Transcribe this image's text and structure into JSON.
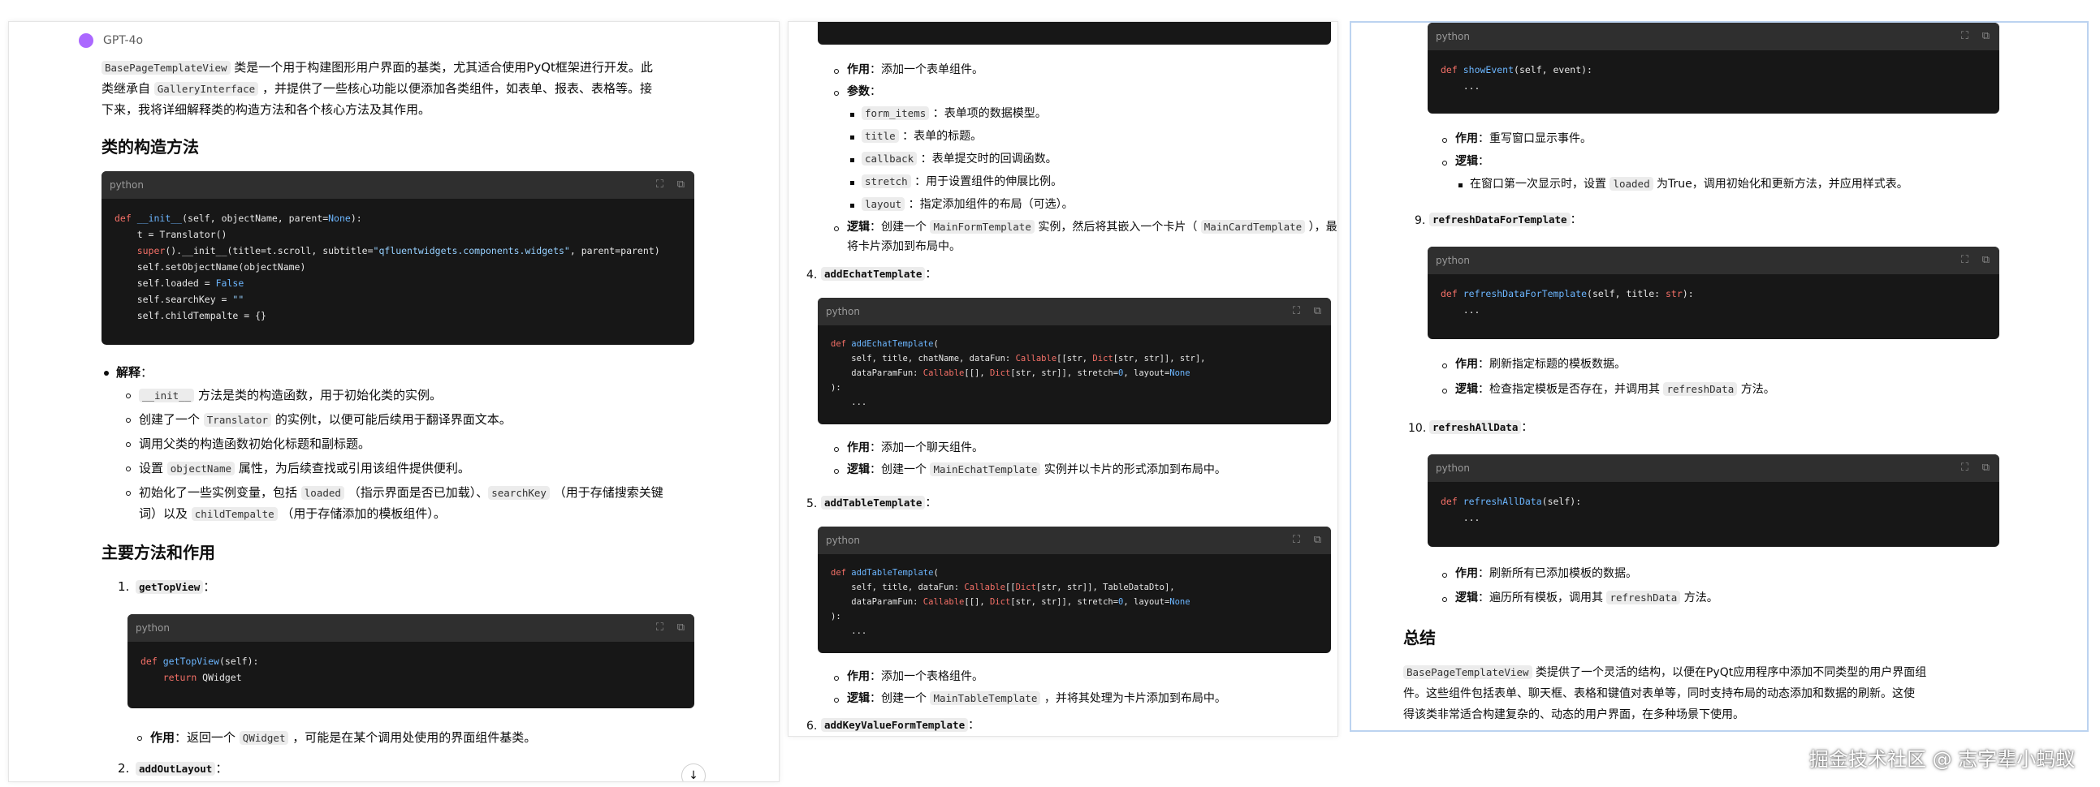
{
  "p1": {
    "model_label": "GPT-4o",
    "intro": {
      "c1": "BasePageTemplateView",
      "t1": " 类是一个用于构建图形用户界面的基类，尤其适合使用PyQt框架进行开发。此",
      "t2": "类继承自 ",
      "c2": "GalleryInterface",
      "t3": " ，并提供了一些核心功能以便添加各类组件，如表单、报表、表格等。接",
      "t4": "下来，我将详细解释类的构造方法和各个核心方法及其作用。"
    },
    "h_ctor": "类的构造方法",
    "code1_lang": "python",
    "explain_label": "解释",
    "explain_items": [
      {
        "code": "__init__",
        "text": " 方法是类的构造函数，用于初始化类的实例。"
      },
      {
        "pre": "创建了一个 ",
        "code": "Translator",
        "text": " 的实例t，以便可能后续用于翻译界面文本。"
      },
      {
        "text": "调用父类的构造函数初始化标题和副标题。"
      },
      {
        "pre": "设置 ",
        "code": "objectName",
        "text": " 属性，为后续查找或引用该组件提供便利。"
      }
    ],
    "explain_last": {
      "a": "初始化了一些实例变量，包括 ",
      "c1": "loaded",
      "b": " （指示界面是否已加载）、",
      "c2": "searchKey",
      "c": " （用于存储搜索关键",
      "d": "词）以及 ",
      "c3": "childTempalte",
      "e": " （用于存储添加的模板组件）。"
    },
    "h_methods": "主要方法和作用",
    "m1_num": "1.",
    "m1_name": "getTopView",
    "colon": "：",
    "code2_lang": "python",
    "m1_role_label": "作用",
    "m1_role_a": "：返回一个 ",
    "m1_role_code": "QWidget",
    "m1_role_b": " ，可能是在某个调用处使用的界面组件基类。",
    "m2_num": "2.",
    "m2_name": "addOutLayout",
    "scroll_down": "↓"
  },
  "p2": {
    "role_label": "作用",
    "param_label": "参数",
    "logic_label": "逻辑",
    "i1_role": "：添加一个表单组件。",
    "params": [
      {
        "code": "form_items",
        "text": " ：表单项的数据模型。"
      },
      {
        "code": "title",
        "text": " ：表单的标题。"
      },
      {
        "code": "callback",
        "text": " ：表单提交时的回调函数。"
      },
      {
        "code": "stretch",
        "text": " ：用于设置组件的伸展比例。"
      },
      {
        "code": "layout",
        "text": " ：指定添加组件的布局（可选）。"
      }
    ],
    "i1_logic": {
      "a": "：创建一个 ",
      "c1": "MainFormTemplate",
      "b": " 实例，然后将其嵌入一个卡片（ ",
      "c2": "MainCardTemplate",
      "c": " ），最后",
      "d": "将卡片添加到布局中。"
    },
    "m4_num": "4.",
    "m4_name": "addEchatTemplate",
    "colon": "：",
    "code4_lang": "python",
    "i4_role": "：添加一个聊天组件。",
    "i4_logic_a": "：创建一个 ",
    "i4_logic_code": "MainEchatTemplate",
    "i4_logic_b": " 实例并以卡片的形式添加到布局中。",
    "m5_num": "5.",
    "m5_name": "addTableTemplate",
    "code5_lang": "python",
    "i5_role": "：添加一个表格组件。",
    "i5_logic_a": "：创建一个 ",
    "i5_logic_code": "MainTableTemplate",
    "i5_logic_b": " ，并将其处理为卡片添加到布局中。",
    "m6_num": "6.",
    "m6_name": "addKeyValueFormTemplate"
  },
  "p3": {
    "role_label": "作用",
    "logic_label": "逻辑",
    "colon": "：",
    "code8_lang": "python",
    "i8_role": "：重写窗口显示事件。",
    "i8_logic_a": "在窗口第一次显示时，设置 ",
    "i8_logic_code": "loaded",
    "i8_logic_b": " 为True，调用初始化和更新方法，并应用样式表。",
    "m9_num": "9.",
    "m9_name": "refreshDataForTemplate",
    "code9_lang": "python",
    "i9_role": "：刷新指定标题的模板数据。",
    "i9_logic_a": "：检查指定模板是否存在，并调用其 ",
    "i9_logic_code": "refreshData",
    "i9_logic_b": " 方法。",
    "m10_num": "10.",
    "m10_name": "refreshAllData",
    "code10_lang": "python",
    "i10_role": "：刷新所有已添加模板的数据。",
    "i10_logic_a": "：遍历所有模板，调用其 ",
    "i10_logic_code": "refreshData",
    "i10_logic_b": " 方法。",
    "h_summary": "总结",
    "summary": {
      "c1": "BasePageTemplateView",
      "t1": " 类提供了一个灵活的结构，以便在PyQt应用程序中添加不同类型的用户界面组",
      "t2": "件。这些组件包括表单、聊天框、表格和键值对表单等，同时支持布局的动态添加和数据的刷新。这使",
      "t3": "得该类非常适合构建复杂的、动态的用户界面，在多种场景下使用。"
    }
  },
  "watermark": "掘金技术社区 @ 志字辈小蚂蚁"
}
